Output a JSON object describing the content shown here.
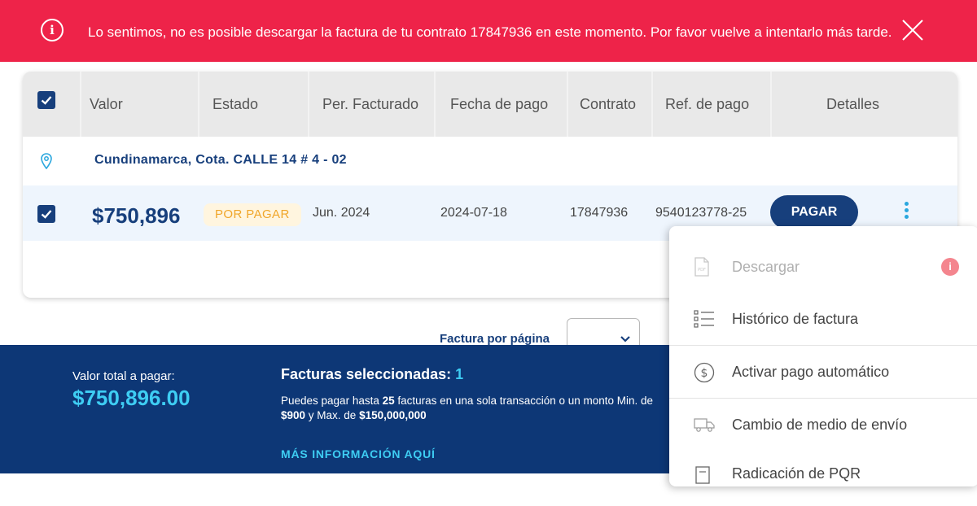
{
  "alert": {
    "message": "Lo sentimos, no es posible descargar la factura de tu contrato 17847936 en este momento. Por favor vuelve a intentarlo más tarde.",
    "icon": "info-icon",
    "color": "#ee2349"
  },
  "table": {
    "headers": [
      "Valor",
      "Estado",
      "Per. Facturado",
      "Fecha de pago",
      "Contrato",
      "Ref. de pago",
      "Detalles"
    ],
    "location": "Cundinamarca, Cota. CALLE 14 # 4 - 02",
    "rows": [
      {
        "valor": "$750,896",
        "estado": "POR PAGAR",
        "periodo": "Jun. 2024",
        "fecha": "2024-07-18",
        "contrato": "17847936",
        "ref": "9540123778-25",
        "action_label": "PAGAR"
      }
    ]
  },
  "pagination": {
    "label": "Factura por página"
  },
  "footer": {
    "total_label": "Valor total a pagar:",
    "total_value": "$750,896.00",
    "selected_label": "Facturas seleccionadas:",
    "selected_count": "1",
    "info_pre": "Puedes pagar hasta ",
    "info_bold1": "25",
    "info_mid": " facturas en una sola transacción o un monto Min. de ",
    "info_bold2": "$900",
    "info_mid2": " y Max. de ",
    "info_bold3": "$150,000,000",
    "more_info": "MÁS INFORMACIÓN AQUÍ"
  },
  "menu": {
    "items": [
      {
        "label": "Descargar",
        "icon": "pdf-icon",
        "disabled": true
      },
      {
        "label": "Histórico de factura",
        "icon": "list-icon"
      },
      {
        "label": "Activar pago automático",
        "icon": "dollar-circle-icon"
      },
      {
        "label": "Cambio de medio de envío",
        "icon": "truck-icon"
      },
      {
        "label": "Radicación de PQR",
        "icon": "document-icon"
      }
    ]
  },
  "colors": {
    "primary": "#173f7c",
    "accent": "#3ecdf3",
    "footer": "#0d3776",
    "badge_text": "#f0a62a"
  }
}
